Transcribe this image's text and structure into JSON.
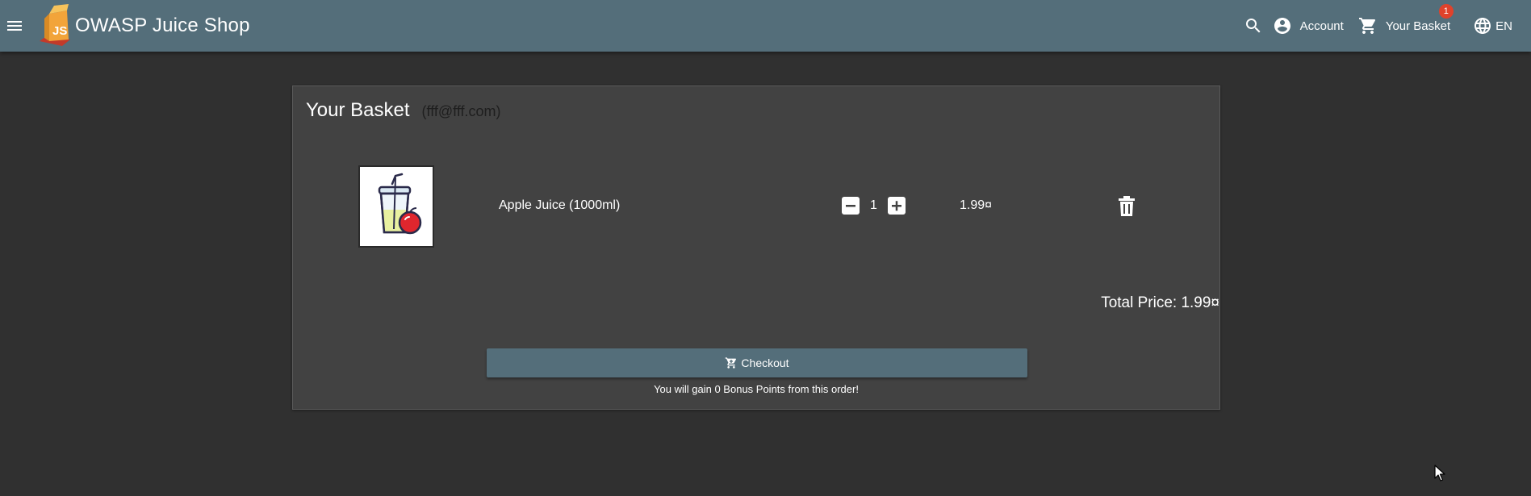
{
  "app": {
    "title": "OWASP Juice Shop"
  },
  "toolbar": {
    "menu_icon": "menu-icon",
    "search_icon": "search-icon",
    "account_label": "Account",
    "basket_label": "Your Basket",
    "basket_count": "1",
    "language_label": "EN",
    "bg_color": "#546e7a",
    "badge_color": "#e0422b"
  },
  "basket": {
    "title": "Your Basket",
    "user_email": "(fff@fff.com)",
    "items": [
      {
        "name": "Apple Juice (1000ml)",
        "quantity": "1",
        "price": "1.99¤"
      }
    ],
    "total_label": "Total Price: 1.99¤",
    "checkout_label": "Checkout",
    "bonus_text": "You will gain 0 Bonus Points from this order!"
  }
}
